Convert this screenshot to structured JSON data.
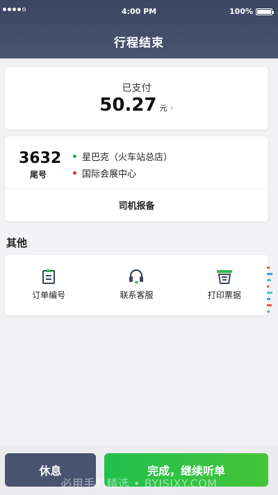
{
  "status_bar": {
    "time": "4:00 PM",
    "battery": "100%"
  },
  "header": {
    "title": "行程结束"
  },
  "payment": {
    "status": "已支付",
    "amount": "50.27",
    "unit": "元",
    "chevron": "›"
  },
  "trip": {
    "tail_number": "3632",
    "tail_label": "尾号",
    "origin": "星巴克（火车站总店）",
    "destination": "国际会展中心",
    "report_label": "司机报备"
  },
  "others": {
    "title": "其他",
    "items": [
      {
        "label": "订单编号",
        "icon": "clipboard-icon"
      },
      {
        "label": "联系客服",
        "icon": "headset-icon"
      },
      {
        "label": "打印票据",
        "icon": "printer-icon"
      }
    ]
  },
  "bottom": {
    "rest_label": "休息",
    "continue_label": "完成，继续听单"
  },
  "watermark": "必用手机精选 • BYJSJXY.COM",
  "colors": {
    "header": "#3d4661",
    "green": "#2dbf48",
    "origin_dot": "#22b34c",
    "destination_dot": "#e0302a",
    "rest": "#4a5470"
  }
}
